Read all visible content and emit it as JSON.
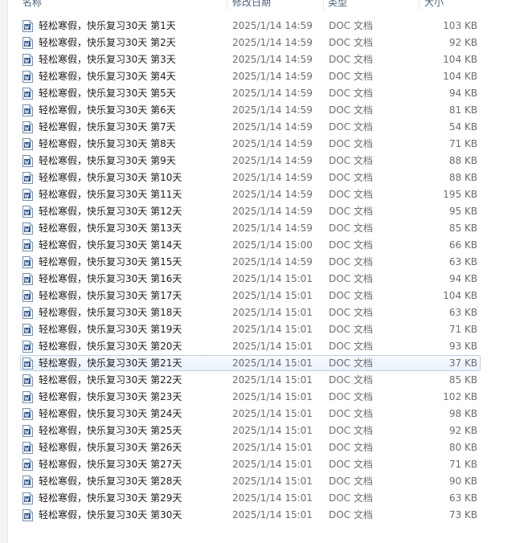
{
  "columns": {
    "name": "名称",
    "date": "修改日期",
    "type": "类型",
    "size": "大小"
  },
  "selected_index": 20,
  "icon": "word-doc-icon",
  "files": [
    {
      "name": "轻松寒假，快乐复习30天 第1天",
      "date": "2025/1/14 14:59",
      "type": "DOC 文档",
      "size": "103 KB"
    },
    {
      "name": "轻松寒假，快乐复习30天 第2天",
      "date": "2025/1/14 14:59",
      "type": "DOC 文档",
      "size": "92 KB"
    },
    {
      "name": "轻松寒假，快乐复习30天 第3天",
      "date": "2025/1/14 14:59",
      "type": "DOC 文档",
      "size": "104 KB"
    },
    {
      "name": "轻松寒假，快乐复习30天 第4天",
      "date": "2025/1/14 14:59",
      "type": "DOC 文档",
      "size": "104 KB"
    },
    {
      "name": "轻松寒假，快乐复习30天 第5天",
      "date": "2025/1/14 14:59",
      "type": "DOC 文档",
      "size": "94 KB"
    },
    {
      "name": "轻松寒假，快乐复习30天 第6天",
      "date": "2025/1/14 14:59",
      "type": "DOC 文档",
      "size": "81 KB"
    },
    {
      "name": "轻松寒假，快乐复习30天 第7天",
      "date": "2025/1/14 14:59",
      "type": "DOC 文档",
      "size": "54 KB"
    },
    {
      "name": "轻松寒假，快乐复习30天 第8天",
      "date": "2025/1/14 14:59",
      "type": "DOC 文档",
      "size": "71 KB"
    },
    {
      "name": "轻松寒假，快乐复习30天 第9天",
      "date": "2025/1/14 14:59",
      "type": "DOC 文档",
      "size": "88 KB"
    },
    {
      "name": "轻松寒假，快乐复习30天 第10天",
      "date": "2025/1/14 14:59",
      "type": "DOC 文档",
      "size": "88 KB"
    },
    {
      "name": "轻松寒假，快乐复习30天 第11天",
      "date": "2025/1/14 14:59",
      "type": "DOC 文档",
      "size": "195 KB"
    },
    {
      "name": "轻松寒假，快乐复习30天 第12天",
      "date": "2025/1/14 14:59",
      "type": "DOC 文档",
      "size": "95 KB"
    },
    {
      "name": "轻松寒假，快乐复习30天 第13天",
      "date": "2025/1/14 14:59",
      "type": "DOC 文档",
      "size": "85 KB"
    },
    {
      "name": "轻松寒假，快乐复习30天 第14天",
      "date": "2025/1/14 15:00",
      "type": "DOC 文档",
      "size": "66 KB"
    },
    {
      "name": "轻松寒假，快乐复习30天 第15天",
      "date": "2025/1/14 14:59",
      "type": "DOC 文档",
      "size": "63 KB"
    },
    {
      "name": "轻松寒假，快乐复习30天 第16天",
      "date": "2025/1/14 15:01",
      "type": "DOC 文档",
      "size": "94 KB"
    },
    {
      "name": "轻松寒假，快乐复习30天 第17天",
      "date": "2025/1/14 15:01",
      "type": "DOC 文档",
      "size": "104 KB"
    },
    {
      "name": "轻松寒假，快乐复习30天 第18天",
      "date": "2025/1/14 15:01",
      "type": "DOC 文档",
      "size": "63 KB"
    },
    {
      "name": "轻松寒假，快乐复习30天 第19天",
      "date": "2025/1/14 15:01",
      "type": "DOC 文档",
      "size": "71 KB"
    },
    {
      "name": "轻松寒假，快乐复习30天 第20天",
      "date": "2025/1/14 15:01",
      "type": "DOC 文档",
      "size": "93 KB"
    },
    {
      "name": "轻松寒假，快乐复习30天 第21天",
      "date": "2025/1/14 15:01",
      "type": "DOC 文档",
      "size": "37 KB"
    },
    {
      "name": "轻松寒假，快乐复习30天 第22天",
      "date": "2025/1/14 15:01",
      "type": "DOC 文档",
      "size": "85 KB"
    },
    {
      "name": "轻松寒假，快乐复习30天 第23天",
      "date": "2025/1/14 15:01",
      "type": "DOC 文档",
      "size": "102 KB"
    },
    {
      "name": "轻松寒假，快乐复习30天 第24天",
      "date": "2025/1/14 15:01",
      "type": "DOC 文档",
      "size": "98 KB"
    },
    {
      "name": "轻松寒假，快乐复习30天 第25天",
      "date": "2025/1/14 15:01",
      "type": "DOC 文档",
      "size": "92 KB"
    },
    {
      "name": "轻松寒假，快乐复习30天 第26天",
      "date": "2025/1/14 15:01",
      "type": "DOC 文档",
      "size": "80 KB"
    },
    {
      "name": "轻松寒假，快乐复习30天 第27天",
      "date": "2025/1/14 15:01",
      "type": "DOC 文档",
      "size": "71 KB"
    },
    {
      "name": "轻松寒假，快乐复习30天 第28天",
      "date": "2025/1/14 15:01",
      "type": "DOC 文档",
      "size": "90 KB"
    },
    {
      "name": "轻松寒假，快乐复习30天 第29天",
      "date": "2025/1/14 15:01",
      "type": "DOC 文档",
      "size": "63 KB"
    },
    {
      "name": "轻松寒假，快乐复习30天 第30天",
      "date": "2025/1/14 15:01",
      "type": "DOC 文档",
      "size": "73 KB"
    }
  ]
}
